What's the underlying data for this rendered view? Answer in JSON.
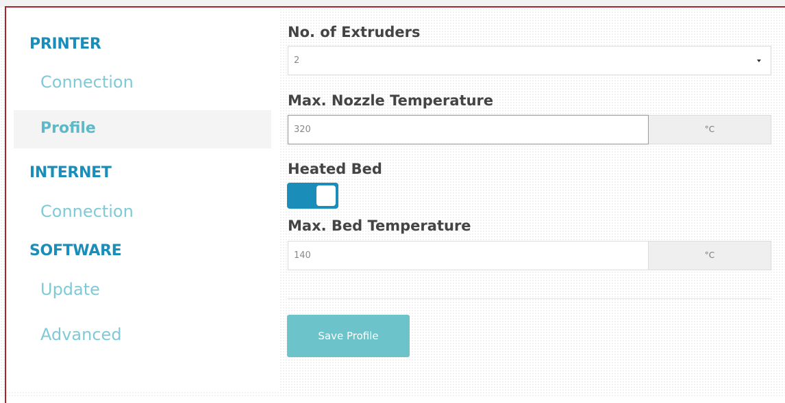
{
  "sidebar": {
    "sections": [
      {
        "title": "PRINTER",
        "items": [
          "Connection",
          "Profile"
        ]
      },
      {
        "title": "INTERNET",
        "items": [
          "Connection"
        ]
      },
      {
        "title": "SOFTWARE",
        "items": [
          "Update",
          "Advanced"
        ]
      }
    ],
    "active_item": "Profile"
  },
  "form": {
    "extruders": {
      "label": "No. of Extruders",
      "value": "2"
    },
    "nozzle_temp": {
      "label": "Max. Nozzle Temperature",
      "value": "320",
      "unit": "°C"
    },
    "heated_bed": {
      "label": "Heated Bed",
      "enabled": true
    },
    "bed_temp": {
      "label": "Max. Bed Temperature",
      "value": "140",
      "unit": "°C"
    },
    "save_label": "Save Profile"
  },
  "colors": {
    "accent": "#1a8db8",
    "nav_text": "#7fcad6",
    "button": "#6cc3c9",
    "frame_border": "#a8262a"
  }
}
